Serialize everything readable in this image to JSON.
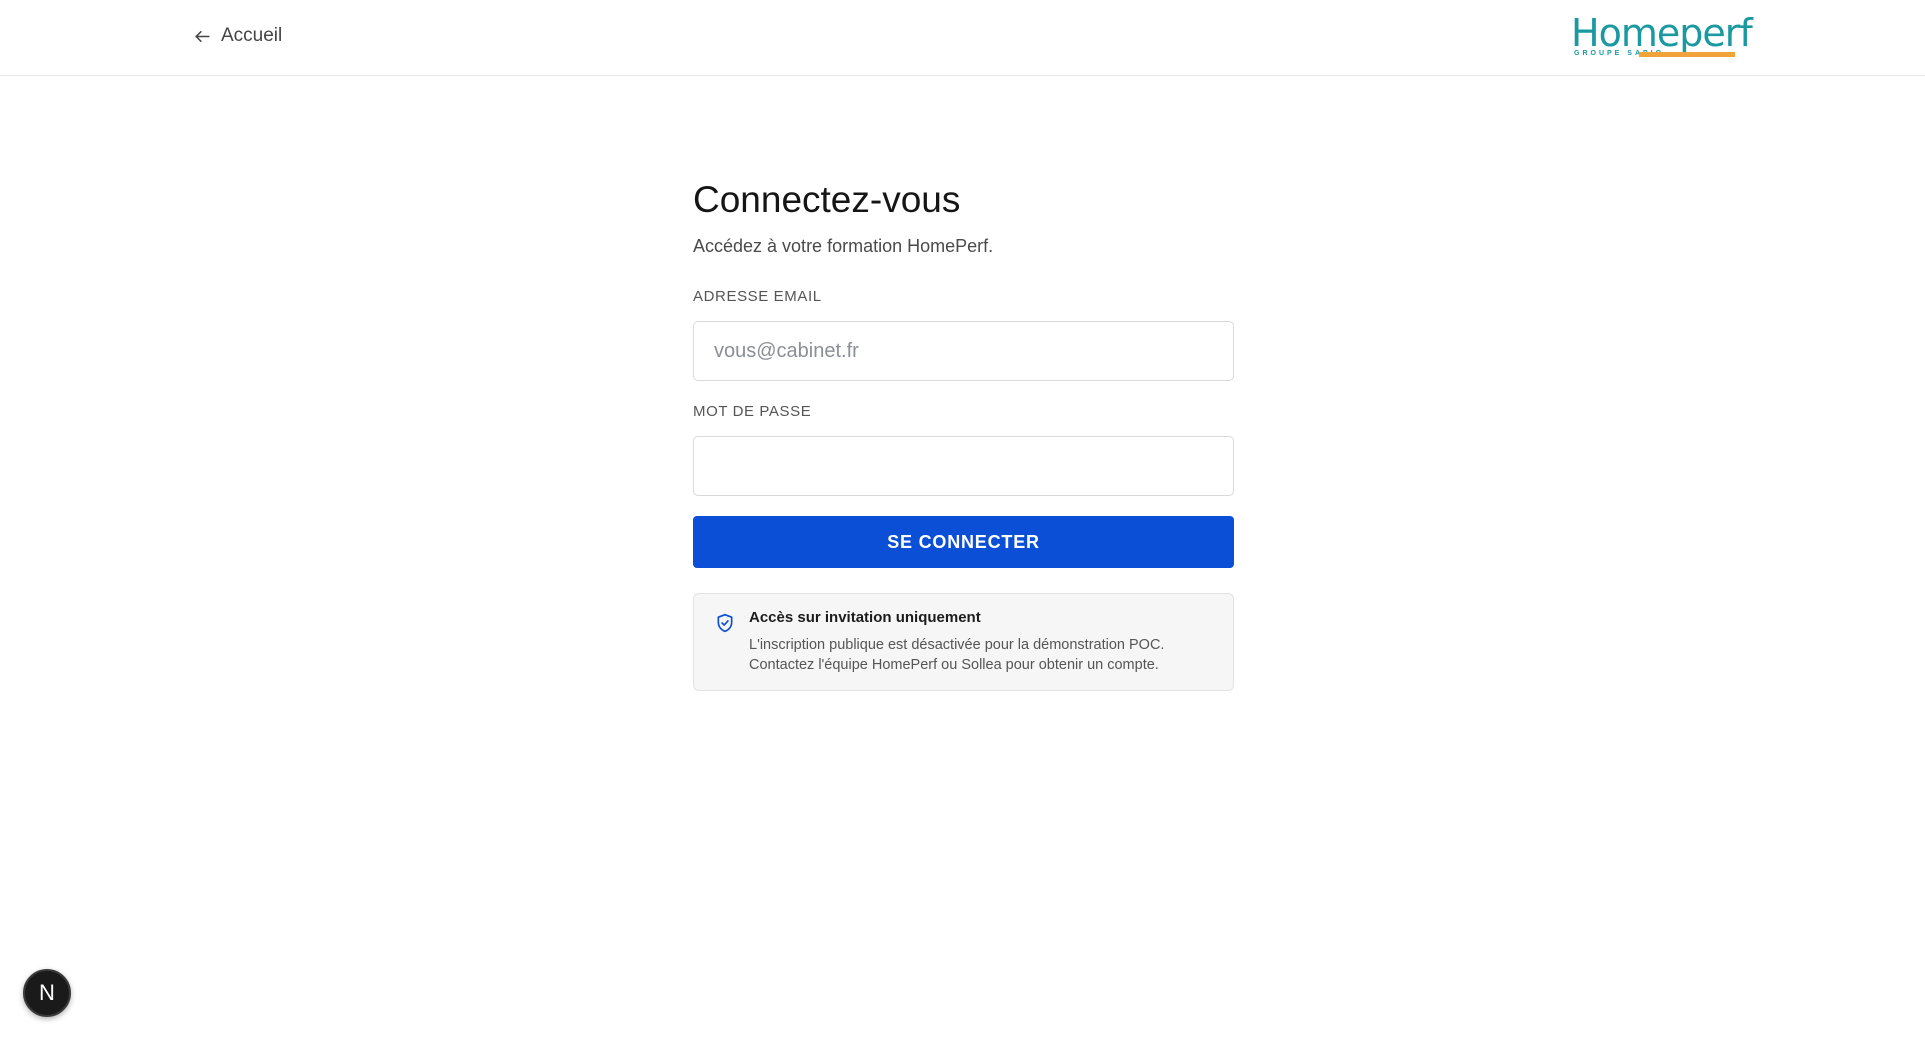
{
  "header": {
    "back_label": "Accueil",
    "back_icon": "arrow-left-icon",
    "logo": {
      "name": "Homeperf",
      "tagline": "GROUPE SAPIO",
      "color": "#1a9aa0",
      "accent_color": "#f2a33a"
    }
  },
  "login": {
    "title": "Connectez-vous",
    "subtitle": "Accédez à votre formation HomePerf.",
    "email_label": "ADRESSE EMAIL",
    "email_placeholder": "vous@cabinet.fr",
    "email_value": "",
    "password_label": "MOT DE PASSE",
    "password_value": "",
    "submit_label": "SE CONNECTER",
    "submit_color": "#0a4fd6"
  },
  "notice": {
    "icon": "shield-check-icon",
    "title": "Accès sur invitation uniquement",
    "line1": "L'inscription publique est désactivée pour la démonstration POC.",
    "line2": "Contactez l'équipe HomePerf ou Sollea pour obtenir un compte."
  },
  "dev_badge": {
    "letter": "N"
  }
}
